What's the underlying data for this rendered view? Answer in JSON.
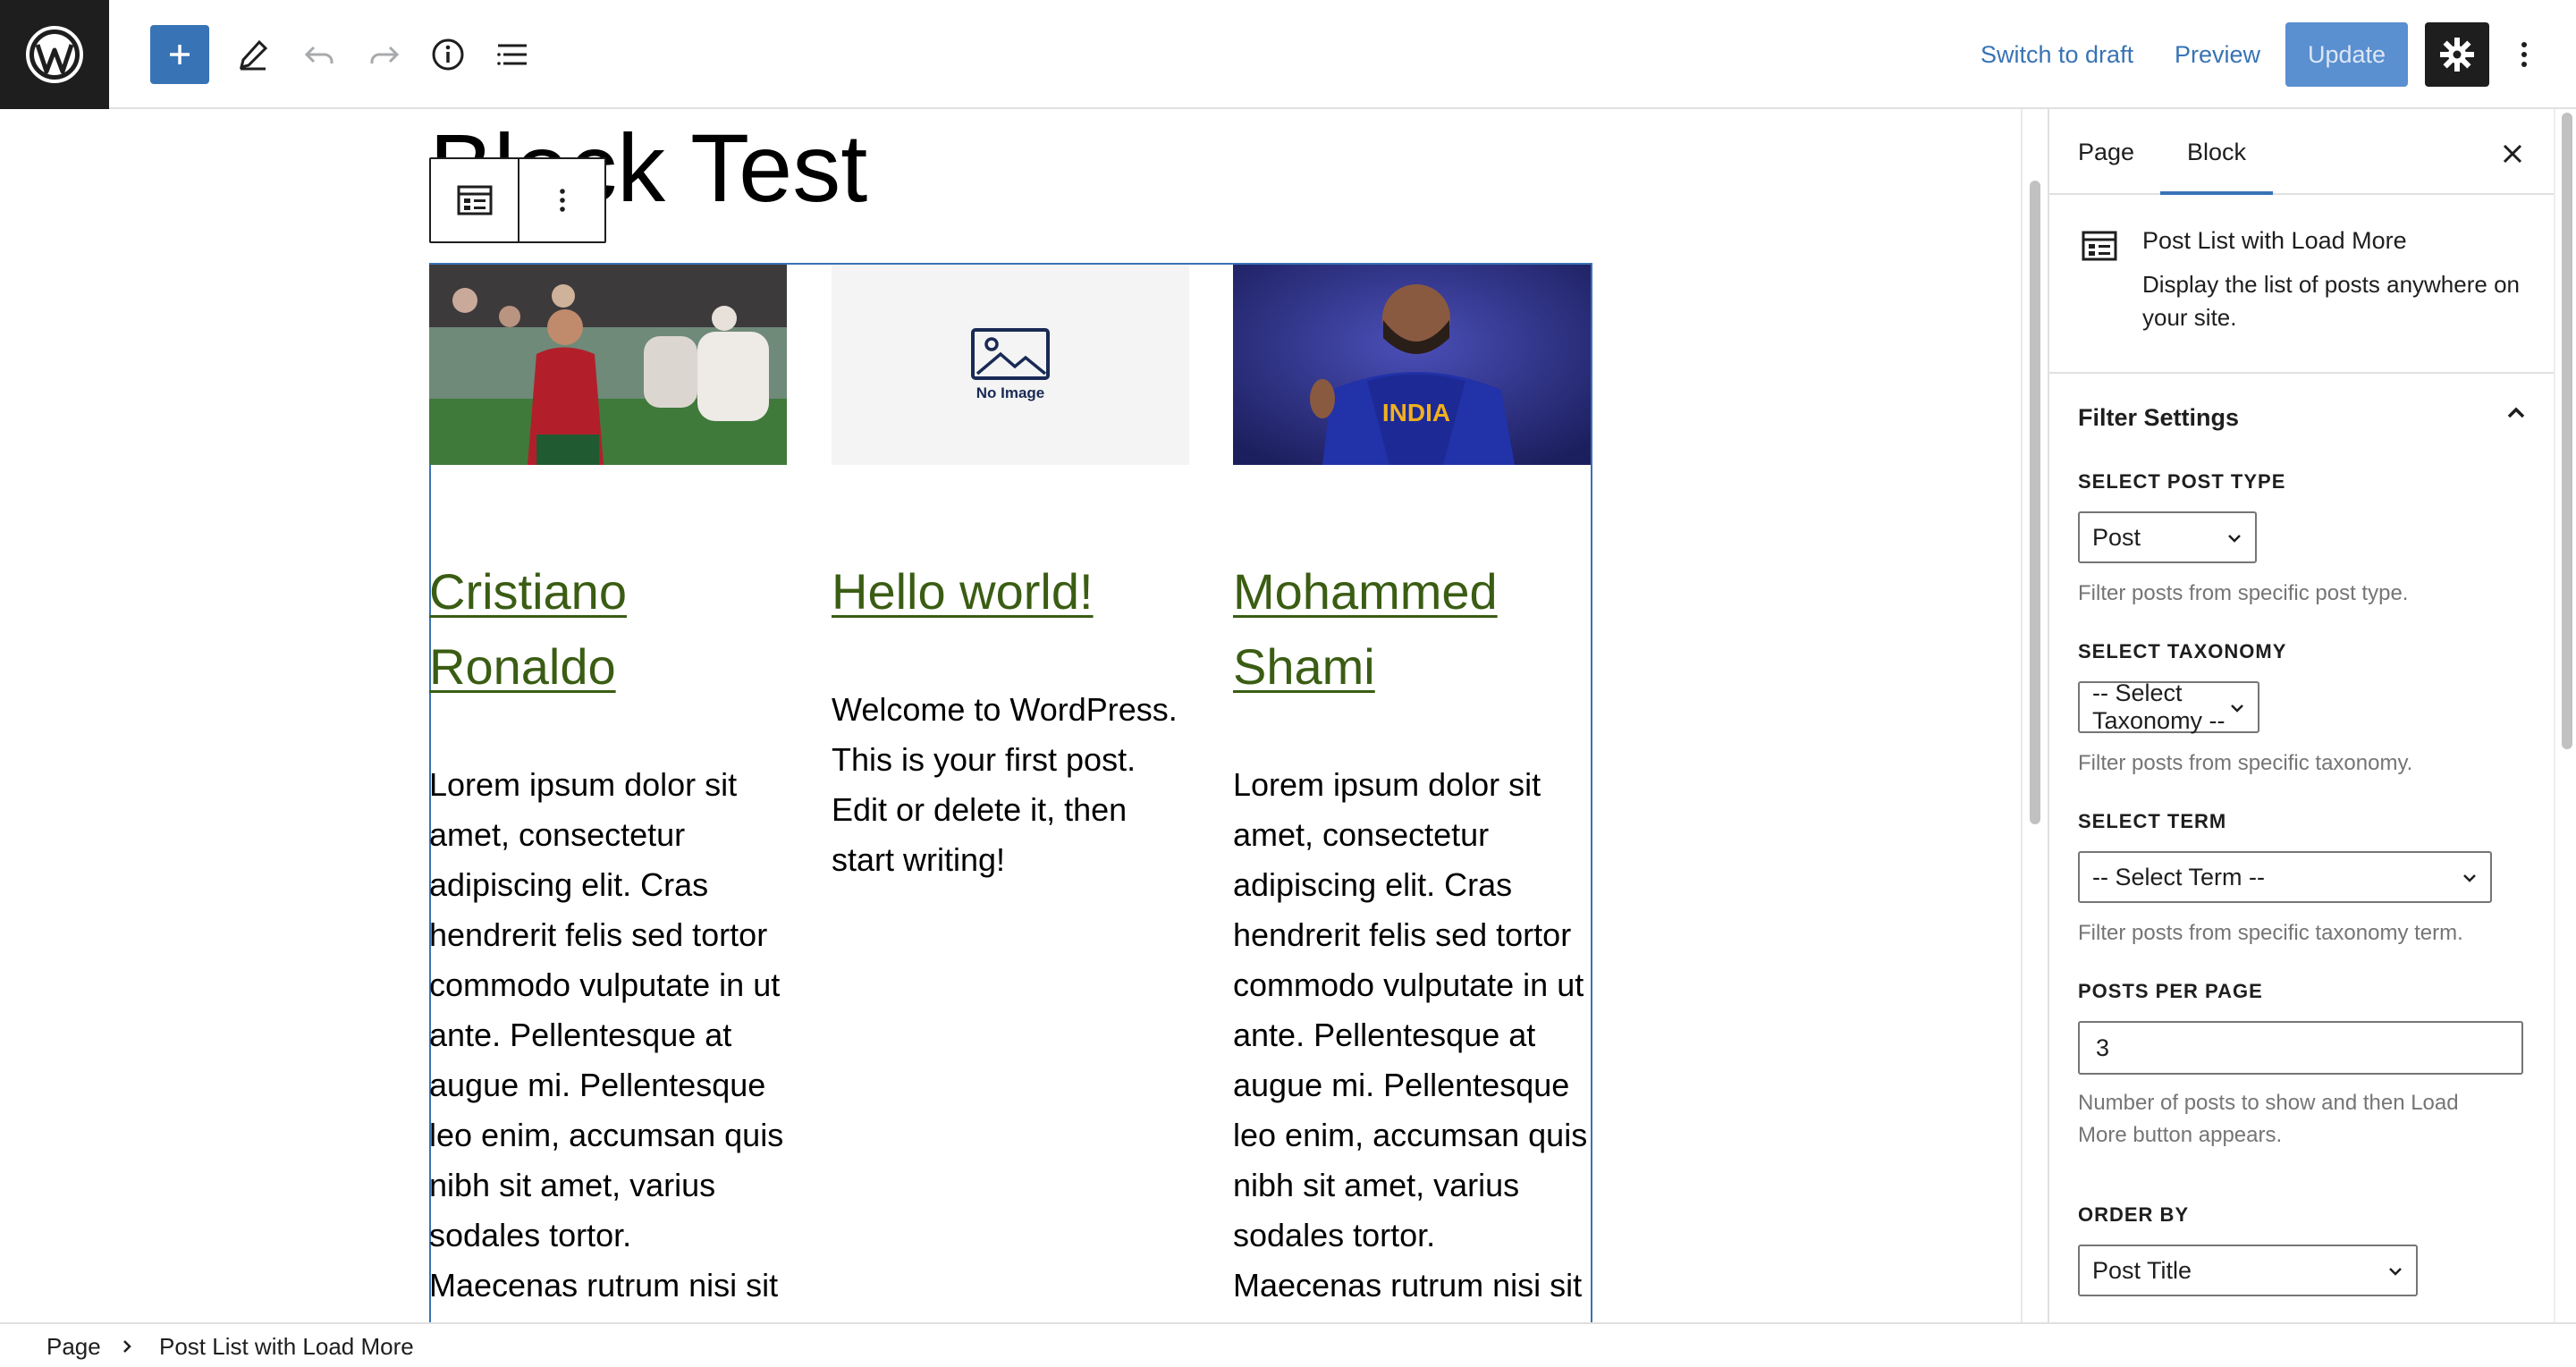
{
  "header": {
    "switch_to_draft": "Switch to draft",
    "preview": "Preview",
    "update": "Update"
  },
  "document": {
    "title": "Block Test"
  },
  "posts": [
    {
      "title": "Cristiano Ronaldo",
      "excerpt": "Lorem ipsum dolor sit amet, consectetur adipiscing elit. Cras hendrerit felis sed tortor commodo vulputate in ut ante. Pellentesque at augue mi. Pellentesque leo enim, accumsan quis nibh sit amet, varius sodales tortor. Maecenas rutrum nisi sit amet"
    },
    {
      "title": "Hello world!",
      "excerpt": "Welcome to WordPress. This is your first post. Edit or delete it, then start writing!",
      "placeholder_text": "No Image"
    },
    {
      "title": "Mohammed Shami",
      "excerpt": "Lorem ipsum dolor sit amet, consectetur adipiscing elit. Cras hendrerit felis sed tortor commodo vulputate in ut ante. Pellentesque at augue mi. Pellentesque leo enim, accumsan quis nibh sit amet, varius sodales tortor. Maecenas rutrum nisi sit amet",
      "jersey_text": "INDIA"
    }
  ],
  "sidebar": {
    "tabs": [
      "Page",
      "Block"
    ],
    "active_tab": "Block",
    "block": {
      "name": "Post List with Load More",
      "description": "Display the list of posts anywhere on your site."
    },
    "panel_title": "Filter Settings",
    "fields": {
      "post_type": {
        "label": "SELECT POST TYPE",
        "value": "Post",
        "help": "Filter posts from specific post type."
      },
      "taxonomy": {
        "label": "SELECT TAXONOMY",
        "value": "-- Select Taxonomy --",
        "help": "Filter posts from specific taxonomy."
      },
      "term": {
        "label": "SELECT TERM",
        "value": "-- Select Term --",
        "help": "Filter posts from specific taxonomy term."
      },
      "posts_per_page": {
        "label": "POSTS PER PAGE",
        "value": "3",
        "help": "Number of posts to show and then Load More button appears."
      },
      "order_by": {
        "label": "ORDER BY",
        "value": "Post Title"
      }
    }
  },
  "breadcrumb": [
    "Page",
    "Post List with Load More"
  ],
  "colors": {
    "accent": "#3873b5",
    "link": "#3a5d13",
    "dark": "#1e1e1e",
    "update_button": "#5a8fd0"
  },
  "icons": [
    "wordpress-logo-icon",
    "plus-icon",
    "pencil-icon",
    "undo-icon",
    "redo-icon",
    "info-icon",
    "list-view-icon",
    "gear-icon",
    "more-vertical-icon",
    "close-icon",
    "chevron-up-icon",
    "chevron-down-icon",
    "block-list-icon",
    "chevron-right-icon"
  ]
}
